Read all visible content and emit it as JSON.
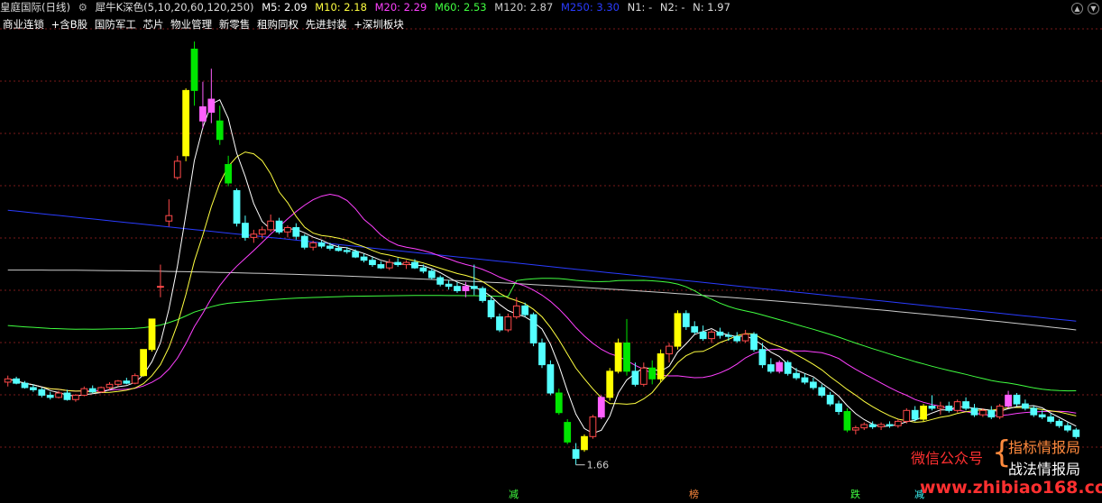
{
  "header": {
    "stock": "皇庭国际(日线)",
    "indicator": "犀牛K深色(5,10,20,60,120,250)",
    "ma": [
      {
        "label": "M5: 2.09",
        "color": "#ffffff"
      },
      {
        "label": "M10: 2.18",
        "color": "#ffff40"
      },
      {
        "label": "M20: 2.29",
        "color": "#ff40ff"
      },
      {
        "label": "M60: 2.53",
        "color": "#40ff40"
      },
      {
        "label": "M120: 2.87",
        "color": "#cccccc"
      },
      {
        "label": "M250: 3.30",
        "color": "#2a3cff"
      }
    ],
    "n_values": [
      "N1: -",
      "N2: -",
      "N: 1.97"
    ]
  },
  "concepts": [
    "商业连锁",
    "+含B股",
    "国防军工",
    "芯片",
    "物业管理",
    "新零售",
    "租购同权",
    "先进封装",
    "+深圳板块"
  ],
  "annotation_low": "1.66",
  "signals": [
    {
      "label": "减",
      "color": "#40ff40"
    },
    {
      "label": "榜",
      "color": "#ff8a3d"
    },
    {
      "label": "跌",
      "color": "#40ff40"
    },
    {
      "label": "减",
      "color": "#40ffff"
    }
  ],
  "watermark": {
    "left": "微信公众号",
    "right_top": "指标情报局",
    "right_bottom": "战法情报局",
    "url": "www.zhibiao168.com"
  },
  "colors": {
    "up": "#ff4a4a",
    "down": "#54ffff",
    "yellow": "#ffff00",
    "green": "#00e600",
    "pink": "#ff60ff",
    "grid": "#7a1a1a"
  },
  "chart_data": {
    "type": "candlestick",
    "ylim": [
      1.5,
      5.6
    ],
    "grid": true,
    "candles": [
      {
        "o": 2.42,
        "h": 2.48,
        "l": 2.38,
        "c": 2.45
      },
      {
        "o": 2.45,
        "h": 2.47,
        "l": 2.4,
        "c": 2.41
      },
      {
        "o": 2.41,
        "h": 2.43,
        "l": 2.36,
        "c": 2.37
      },
      {
        "o": 2.37,
        "h": 2.4,
        "l": 2.33,
        "c": 2.35
      },
      {
        "o": 2.35,
        "h": 2.37,
        "l": 2.28,
        "c": 2.3
      },
      {
        "o": 2.3,
        "h": 2.33,
        "l": 2.26,
        "c": 2.28
      },
      {
        "o": 2.28,
        "h": 2.34,
        "l": 2.27,
        "c": 2.32
      },
      {
        "o": 2.32,
        "h": 2.35,
        "l": 2.25,
        "c": 2.26
      },
      {
        "o": 2.26,
        "h": 2.31,
        "l": 2.24,
        "c": 2.3
      },
      {
        "o": 2.3,
        "h": 2.38,
        "l": 2.29,
        "c": 2.36
      },
      {
        "o": 2.36,
        "h": 2.39,
        "l": 2.32,
        "c": 2.33
      },
      {
        "o": 2.33,
        "h": 2.38,
        "l": 2.32,
        "c": 2.37
      },
      {
        "o": 2.37,
        "h": 2.42,
        "l": 2.35,
        "c": 2.4
      },
      {
        "o": 2.4,
        "h": 2.44,
        "l": 2.38,
        "c": 2.43
      },
      {
        "o": 2.43,
        "h": 2.46,
        "l": 2.4,
        "c": 2.41
      },
      {
        "o": 2.41,
        "h": 2.5,
        "l": 2.4,
        "c": 2.48
      },
      {
        "o": 2.48,
        "h": 2.72,
        "l": 2.47,
        "c": 2.72,
        "k": "yellow"
      },
      {
        "o": 2.72,
        "h": 3.0,
        "l": 2.7,
        "c": 3.0,
        "k": "yellow"
      },
      {
        "o": 3.3,
        "h": 3.5,
        "l": 3.2,
        "c": 3.3
      },
      {
        "o": 3.9,
        "h": 4.1,
        "l": 3.85,
        "c": 3.95
      },
      {
        "o": 4.3,
        "h": 4.5,
        "l": 4.28,
        "c": 4.45
      },
      {
        "o": 4.5,
        "h": 5.12,
        "l": 4.45,
        "c": 5.1,
        "k": "yellow"
      },
      {
        "o": 5.1,
        "h": 5.55,
        "l": 4.96,
        "c": 5.48,
        "k": "green"
      },
      {
        "o": 4.95,
        "h": 5.18,
        "l": 4.75,
        "c": 4.82,
        "k": "pink"
      },
      {
        "o": 4.9,
        "h": 5.3,
        "l": 4.8,
        "c": 5.02,
        "k": "pink"
      },
      {
        "o": 4.82,
        "h": 4.96,
        "l": 4.6,
        "c": 4.65,
        "k": "green"
      },
      {
        "o": 4.42,
        "h": 4.5,
        "l": 4.22,
        "c": 4.25,
        "k": "green"
      },
      {
        "o": 4.18,
        "h": 4.2,
        "l": 3.85,
        "c": 3.88
      },
      {
        "o": 3.88,
        "h": 3.95,
        "l": 3.72,
        "c": 3.75
      },
      {
        "o": 3.75,
        "h": 3.82,
        "l": 3.7,
        "c": 3.78
      },
      {
        "o": 3.78,
        "h": 3.85,
        "l": 3.74,
        "c": 3.82
      },
      {
        "o": 3.82,
        "h": 3.96,
        "l": 3.8,
        "c": 3.9
      },
      {
        "o": 3.9,
        "h": 3.93,
        "l": 3.78,
        "c": 3.8
      },
      {
        "o": 3.8,
        "h": 3.86,
        "l": 3.75,
        "c": 3.84
      },
      {
        "o": 3.84,
        "h": 3.88,
        "l": 3.73,
        "c": 3.76
      },
      {
        "o": 3.76,
        "h": 3.78,
        "l": 3.64,
        "c": 3.66
      },
      {
        "o": 3.66,
        "h": 3.72,
        "l": 3.63,
        "c": 3.7
      },
      {
        "o": 3.7,
        "h": 3.72,
        "l": 3.65,
        "c": 3.67
      },
      {
        "o": 3.67,
        "h": 3.7,
        "l": 3.63,
        "c": 3.65
      },
      {
        "o": 3.65,
        "h": 3.68,
        "l": 3.62,
        "c": 3.63
      },
      {
        "o": 3.63,
        "h": 3.66,
        "l": 3.6,
        "c": 3.62
      },
      {
        "o": 3.62,
        "h": 3.64,
        "l": 3.56,
        "c": 3.57
      },
      {
        "o": 3.57,
        "h": 3.6,
        "l": 3.52,
        "c": 3.54
      },
      {
        "o": 3.54,
        "h": 3.57,
        "l": 3.48,
        "c": 3.5
      },
      {
        "o": 3.5,
        "h": 3.53,
        "l": 3.46,
        "c": 3.47
      },
      {
        "o": 3.47,
        "h": 3.55,
        "l": 3.45,
        "c": 3.52
      },
      {
        "o": 3.52,
        "h": 3.56,
        "l": 3.48,
        "c": 3.5
      },
      {
        "o": 3.5,
        "h": 3.54,
        "l": 3.46,
        "c": 3.52
      },
      {
        "o": 3.52,
        "h": 3.55,
        "l": 3.46,
        "c": 3.47
      },
      {
        "o": 3.47,
        "h": 3.5,
        "l": 3.42,
        "c": 3.44
      },
      {
        "o": 3.44,
        "h": 3.46,
        "l": 3.36,
        "c": 3.38
      },
      {
        "o": 3.38,
        "h": 3.4,
        "l": 3.3,
        "c": 3.32
      },
      {
        "o": 3.32,
        "h": 3.36,
        "l": 3.27,
        "c": 3.3
      },
      {
        "o": 3.3,
        "h": 3.34,
        "l": 3.24,
        "c": 3.26
      },
      {
        "o": 3.26,
        "h": 3.34,
        "l": 3.2,
        "c": 3.3,
        "k": "pink"
      },
      {
        "o": 3.3,
        "h": 3.5,
        "l": 3.22,
        "c": 3.28
      },
      {
        "o": 3.28,
        "h": 3.3,
        "l": 3.15,
        "c": 3.17
      },
      {
        "o": 3.17,
        "h": 3.2,
        "l": 3.0,
        "c": 3.02
      },
      {
        "o": 3.02,
        "h": 3.05,
        "l": 2.88,
        "c": 2.9
      },
      {
        "o": 2.9,
        "h": 3.05,
        "l": 2.88,
        "c": 3.02
      },
      {
        "o": 3.02,
        "h": 3.2,
        "l": 3.0,
        "c": 3.12
      },
      {
        "o": 3.12,
        "h": 3.15,
        "l": 3.02,
        "c": 3.04
      },
      {
        "o": 3.04,
        "h": 3.06,
        "l": 2.75,
        "c": 2.78
      },
      {
        "o": 2.78,
        "h": 2.82,
        "l": 2.55,
        "c": 2.58
      },
      {
        "o": 2.58,
        "h": 2.62,
        "l": 2.3,
        "c": 2.32
      },
      {
        "o": 2.32,
        "h": 2.36,
        "l": 2.12,
        "c": 2.14,
        "k": "green"
      },
      {
        "o": 2.05,
        "h": 2.08,
        "l": 1.85,
        "c": 1.87,
        "k": "green"
      },
      {
        "o": 1.8,
        "h": 1.86,
        "l": 1.66,
        "c": 1.72
      },
      {
        "o": 1.8,
        "h": 1.94,
        "l": 1.78,
        "c": 1.92,
        "k": "yellow"
      },
      {
        "o": 1.92,
        "h": 2.12,
        "l": 1.9,
        "c": 2.1
      },
      {
        "o": 2.1,
        "h": 2.3,
        "l": 2.08,
        "c": 2.28,
        "k": "pink"
      },
      {
        "o": 2.28,
        "h": 2.55,
        "l": 2.25,
        "c": 2.52,
        "k": "yellow"
      },
      {
        "o": 2.52,
        "h": 2.82,
        "l": 2.5,
        "c": 2.78,
        "k": "yellow"
      },
      {
        "o": 2.78,
        "h": 3.0,
        "l": 2.48,
        "c": 2.52,
        "k": "green"
      },
      {
        "o": 2.52,
        "h": 2.6,
        "l": 2.38,
        "c": 2.4
      },
      {
        "o": 2.4,
        "h": 2.6,
        "l": 2.38,
        "c": 2.55
      },
      {
        "o": 2.55,
        "h": 2.62,
        "l": 2.4,
        "c": 2.45,
        "k": "green"
      },
      {
        "o": 2.45,
        "h": 2.72,
        "l": 2.42,
        "c": 2.68,
        "k": "yellow"
      },
      {
        "o": 2.68,
        "h": 2.78,
        "l": 2.6,
        "c": 2.75
      },
      {
        "o": 2.75,
        "h": 3.08,
        "l": 2.72,
        "c": 3.05,
        "k": "yellow"
      },
      {
        "o": 3.05,
        "h": 3.08,
        "l": 2.9,
        "c": 2.93
      },
      {
        "o": 2.93,
        "h": 2.98,
        "l": 2.86,
        "c": 2.88
      },
      {
        "o": 2.88,
        "h": 2.94,
        "l": 2.8,
        "c": 2.82
      },
      {
        "o": 2.82,
        "h": 2.9,
        "l": 2.78,
        "c": 2.88
      },
      {
        "o": 2.88,
        "h": 2.92,
        "l": 2.82,
        "c": 2.85
      },
      {
        "o": 2.85,
        "h": 2.88,
        "l": 2.8,
        "c": 2.84
      },
      {
        "o": 2.84,
        "h": 2.88,
        "l": 2.78,
        "c": 2.8
      },
      {
        "o": 2.8,
        "h": 2.9,
        "l": 2.78,
        "c": 2.86
      },
      {
        "o": 2.86,
        "h": 2.88,
        "l": 2.7,
        "c": 2.72
      },
      {
        "o": 2.72,
        "h": 2.78,
        "l": 2.55,
        "c": 2.58
      },
      {
        "o": 2.58,
        "h": 2.64,
        "l": 2.5,
        "c": 2.52
      },
      {
        "o": 2.52,
        "h": 2.62,
        "l": 2.5,
        "c": 2.6,
        "k": "pink"
      },
      {
        "o": 2.6,
        "h": 2.62,
        "l": 2.48,
        "c": 2.5
      },
      {
        "o": 2.5,
        "h": 2.55,
        "l": 2.44,
        "c": 2.46
      },
      {
        "o": 2.46,
        "h": 2.5,
        "l": 2.4,
        "c": 2.42
      },
      {
        "o": 2.42,
        "h": 2.46,
        "l": 2.35,
        "c": 2.37
      },
      {
        "o": 2.37,
        "h": 2.4,
        "l": 2.28,
        "c": 2.3
      },
      {
        "o": 2.3,
        "h": 2.33,
        "l": 2.2,
        "c": 2.22
      },
      {
        "o": 2.22,
        "h": 2.25,
        "l": 2.12,
        "c": 2.15
      },
      {
        "o": 2.15,
        "h": 2.18,
        "l": 1.96,
        "c": 1.98,
        "k": "green"
      },
      {
        "o": 1.98,
        "h": 2.02,
        "l": 1.94,
        "c": 2.0
      },
      {
        "o": 2.0,
        "h": 2.05,
        "l": 1.98,
        "c": 2.03
      },
      {
        "o": 2.03,
        "h": 2.06,
        "l": 1.99,
        "c": 2.01
      },
      {
        "o": 2.01,
        "h": 2.05,
        "l": 1.98,
        "c": 2.03
      },
      {
        "o": 2.03,
        "h": 2.06,
        "l": 2.0,
        "c": 2.02
      },
      {
        "o": 2.02,
        "h": 2.08,
        "l": 2.0,
        "c": 2.06
      },
      {
        "o": 2.06,
        "h": 2.18,
        "l": 2.04,
        "c": 2.16
      },
      {
        "o": 2.16,
        "h": 2.2,
        "l": 2.06,
        "c": 2.08
      },
      {
        "o": 2.08,
        "h": 2.22,
        "l": 2.06,
        "c": 2.2,
        "k": "yellow"
      },
      {
        "o": 2.2,
        "h": 2.3,
        "l": 2.16,
        "c": 2.18
      },
      {
        "o": 2.18,
        "h": 2.24,
        "l": 2.12,
        "c": 2.2
      },
      {
        "o": 2.2,
        "h": 2.24,
        "l": 2.14,
        "c": 2.16
      },
      {
        "o": 2.16,
        "h": 2.26,
        "l": 2.14,
        "c": 2.24
      },
      {
        "o": 2.24,
        "h": 2.28,
        "l": 2.16,
        "c": 2.18
      },
      {
        "o": 2.18,
        "h": 2.22,
        "l": 2.1,
        "c": 2.12
      },
      {
        "o": 2.12,
        "h": 2.18,
        "l": 2.1,
        "c": 2.16
      },
      {
        "o": 2.16,
        "h": 2.2,
        "l": 2.08,
        "c": 2.1
      },
      {
        "o": 2.1,
        "h": 2.22,
        "l": 2.08,
        "c": 2.2
      },
      {
        "o": 2.2,
        "h": 2.34,
        "l": 2.18,
        "c": 2.3,
        "k": "pink"
      },
      {
        "o": 2.3,
        "h": 2.32,
        "l": 2.2,
        "c": 2.22
      },
      {
        "o": 2.22,
        "h": 2.26,
        "l": 2.16,
        "c": 2.18
      },
      {
        "o": 2.18,
        "h": 2.2,
        "l": 2.1,
        "c": 2.12
      },
      {
        "o": 2.12,
        "h": 2.16,
        "l": 2.08,
        "c": 2.1
      },
      {
        "o": 2.1,
        "h": 2.13,
        "l": 2.04,
        "c": 2.06
      },
      {
        "o": 2.06,
        "h": 2.08,
        "l": 2.0,
        "c": 2.02
      },
      {
        "o": 2.02,
        "h": 2.05,
        "l": 1.96,
        "c": 1.98
      },
      {
        "o": 1.98,
        "h": 2.0,
        "l": 1.9,
        "c": 1.92
      }
    ],
    "series": [
      {
        "name": "M250",
        "color": "#2a3cff",
        "values_start": 4.0,
        "values_end": 2.98
      },
      {
        "name": "M120",
        "color": "#cccccc"
      },
      {
        "name": "M60",
        "color": "#40ff40"
      },
      {
        "name": "M20",
        "color": "#ff40ff"
      },
      {
        "name": "M10",
        "color": "#ffff40"
      },
      {
        "name": "M5",
        "color": "#ffffff"
      }
    ]
  }
}
